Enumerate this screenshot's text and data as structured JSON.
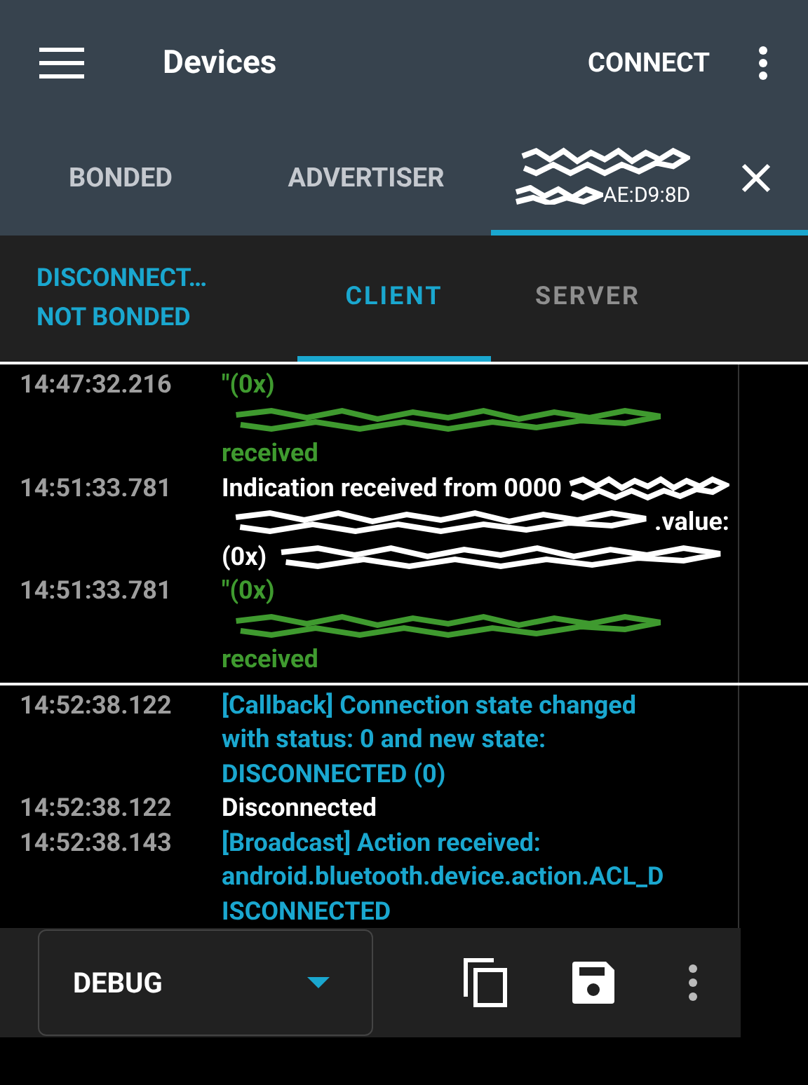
{
  "app_bar": {
    "title": "Devices",
    "action": "CONNECT"
  },
  "tabs": [
    {
      "kind": "text",
      "label": "BONDED",
      "selected": false
    },
    {
      "kind": "text",
      "label": "ADVERTISER",
      "selected": false
    },
    {
      "kind": "device",
      "address": "AE:D9:8D",
      "selected": true
    }
  ],
  "device_bar": {
    "status": [
      "DISCONNECT…",
      "NOT BONDED"
    ],
    "tabs": [
      {
        "label": "CLIENT",
        "selected": true
      },
      {
        "label": "SERVER",
        "selected": false
      }
    ]
  },
  "log": [
    {
      "time": "14:47:32.216",
      "kind": "data",
      "lines": [
        [
          {
            "kind": "text",
            "text": "\"(0x)"
          }
        ],
        [
          {
            "kind": "redacted"
          }
        ],
        [
          {
            "kind": "text",
            "text": "received"
          }
        ]
      ]
    },
    {
      "time": "14:51:33.781",
      "kind": "info",
      "lines": [
        [
          {
            "kind": "text",
            "text": "Indication received from 0000"
          },
          {
            "kind": "redacted"
          }
        ],
        [
          {
            "kind": "redacted"
          },
          {
            "kind": "text",
            "text": ".value:"
          }
        ],
        [
          {
            "kind": "text",
            "text": "(0x)"
          },
          {
            "kind": "redacted"
          }
        ]
      ]
    },
    {
      "time": "14:51:33.781",
      "kind": "data",
      "lines": [
        [
          {
            "kind": "text",
            "text": "\"(0x)"
          }
        ],
        [
          {
            "kind": "redacted"
          }
        ],
        [
          {
            "kind": "text",
            "text": "received"
          }
        ]
      ],
      "divider_after": true
    },
    {
      "time": "14:52:38.122",
      "kind": "event",
      "lines": [
        [
          {
            "kind": "text",
            "text": "[Callback] Connection state changed"
          }
        ],
        [
          {
            "kind": "text",
            "text": "with status: 0 and new state:"
          }
        ],
        [
          {
            "kind": "text",
            "text": "DISCONNECTED (0)"
          }
        ]
      ]
    },
    {
      "time": "14:52:38.122",
      "kind": "info",
      "lines": [
        [
          {
            "kind": "text",
            "text": "Disconnected"
          }
        ]
      ]
    },
    {
      "time": "14:52:38.143",
      "kind": "event",
      "lines": [
        [
          {
            "kind": "text",
            "text": "[Broadcast] Action received:"
          }
        ],
        [
          {
            "kind": "text",
            "text": "android.bluetooth.device.action.ACL_D"
          }
        ],
        [
          {
            "kind": "text",
            "text": "ISCONNECTED"
          }
        ]
      ]
    }
  ],
  "bottom_bar": {
    "level_select": "DEBUG"
  }
}
